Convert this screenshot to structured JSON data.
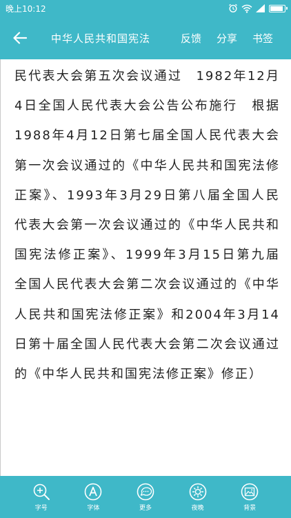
{
  "status_bar": {
    "time": "晚上10:12",
    "icons": [
      "alarm-icon",
      "wifi-icon",
      "signal-icon",
      "battery-icon"
    ],
    "battery_level": 0.9
  },
  "app_bar": {
    "back_icon": "arrow-left-icon",
    "title": "中华人民共和国宪法",
    "actions": [
      "反馈",
      "分享",
      "书签"
    ]
  },
  "content": {
    "text": "民代表大会第五次会议通过　1982年12月4日全国人民代表大会公告公布施行　根据1988年4月12日第七届全国人民代表大会第一次会议通过的《中华人民共和国宪法修正案》、1993年3月29日第八届全国人民代表大会第一次会议通过的《中华人民共和国宪法修正案》、1999年3月15日第九届全国人民代表大会第二次会议通过的《中华人民共和国宪法修正案》和2004年3月14日第十届全国人民代表大会第二次会议通过的《中华人民共和国宪法修正案》修正）"
  },
  "bottom_bar": {
    "items": [
      {
        "label": "字号",
        "icon": "zoom-in-icon"
      },
      {
        "label": "字体",
        "icon": "font-icon"
      },
      {
        "label": "更多",
        "icon": "more-icon"
      },
      {
        "label": "夜晚",
        "icon": "sun-icon"
      },
      {
        "label": "背景",
        "icon": "image-icon"
      }
    ]
  },
  "colors": {
    "primary": "#3fb8c8",
    "text": "#222222",
    "on_primary": "#ffffff"
  }
}
